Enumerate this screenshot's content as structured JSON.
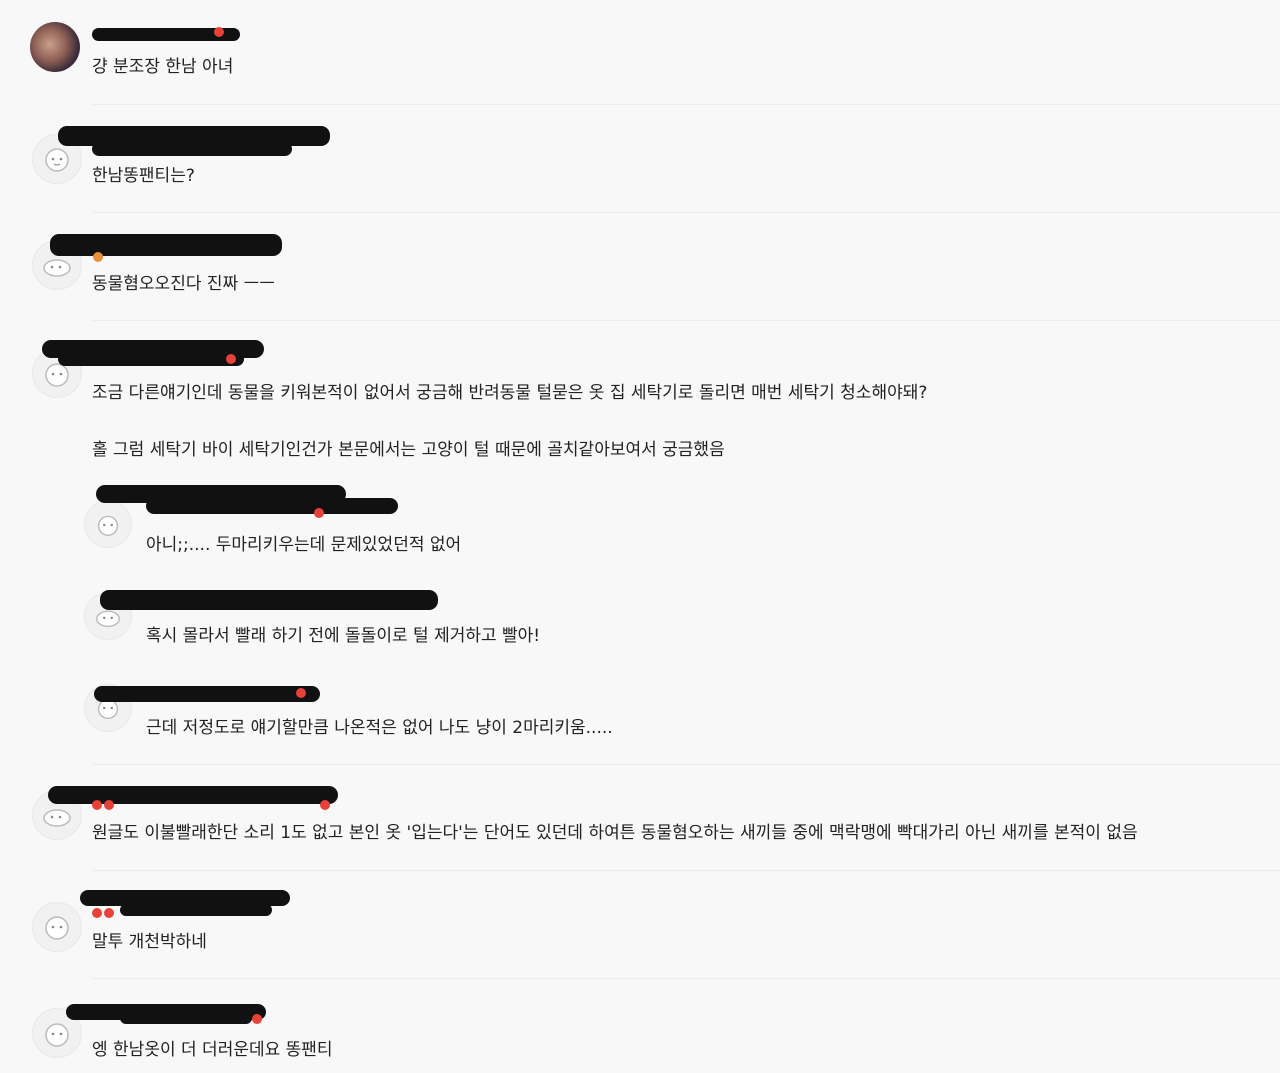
{
  "comments": [
    {
      "text": "걍 분조장 한남 아녀"
    },
    {
      "text": "한남똥팬티는?"
    },
    {
      "text": "동물혐오오진다 진짜 ㅡㅡ"
    },
    {
      "text": "조금 다른얘기인데 동물을 키워본적이 없어서 궁금해 반려동물 털묻은 옷 집 세탁기로 돌리면 매번 세탁기 청소해야돼?",
      "text2": "홀 그럼 세탁기 바이 세탁기인건가 본문에서는 고양이 털 때문에 골치같아보여서 궁금했음"
    },
    {
      "text": "아니;;.... 두마리키우는데 문제있었던적 없어"
    },
    {
      "text": "혹시 몰라서 빨래 하기 전에 돌돌이로 털 제거하고 빨아!"
    },
    {
      "text": "근데 저정도로 얘기할만큼 나온적은 없어 나도 냥이 2마리키움....."
    },
    {
      "text": "원글도 이불빨래한단 소리 1도 없고 본인 옷 '입는다'는 단어도 있던데 하여튼 동물혐오하는 새끼들 중에 맥락맹에 빡대가리 아닌 새끼를 본적이 없음"
    },
    {
      "text": "말투 개천박하네"
    },
    {
      "text": "엥 한남옷이 더 더러운데요 똥팬티"
    }
  ],
  "colors": {
    "background": "#f8f8f8",
    "text": "#222222",
    "badge": "#e8413a",
    "divider": "#ececec"
  }
}
